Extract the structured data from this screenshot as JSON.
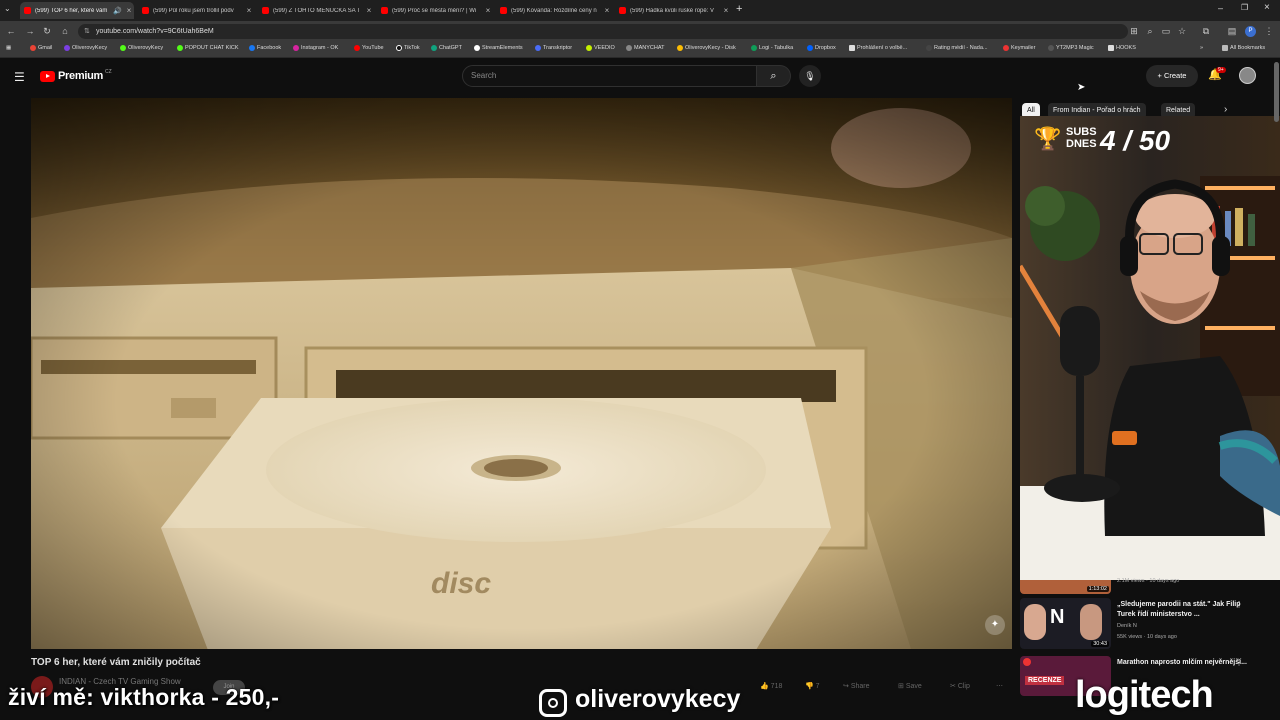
{
  "browser": {
    "tabs": [
      {
        "title": "(599) TOP 6 her, které vám",
        "active": true
      },
      {
        "title": "(599) Půl roku jsem trollil podv",
        "active": false
      },
      {
        "title": "(599) Z TOHTO MENUČKA SA T",
        "active": false
      },
      {
        "title": "(599) Proč se města mění? | Wi",
        "active": false
      },
      {
        "title": "(599) Kovanda: Rozdílné ceny n",
        "active": false
      },
      {
        "title": "(599) Hádka kvůli ruské ropě: V",
        "active": false
      }
    ],
    "url": "youtube.com/watch?v=9C6tUah6BeM",
    "bookmarks": [
      "Gmail",
      "OliverovyKecy",
      "OliverovyKecy",
      "POPOUT CHAT KICK",
      "Facebook",
      "Instagram - OK",
      "YouTube",
      "TikTok",
      "ChatGPT",
      "StreamElements",
      "Transkriptor",
      "VEEDIO",
      "MANYCHAT",
      "OliverovyKecy - Disk",
      "Logi - Tabulka",
      "Dropbox",
      "Prohlášení o volbě...",
      "Rating médií - Nada...",
      "Keymailer",
      "YT2MP3 Magic",
      "HOOKS"
    ],
    "all_bookmarks": "All Bookmarks"
  },
  "youtube": {
    "logo_text": "Premium",
    "country": "CZ",
    "search_placeholder": "Search",
    "create_label": "Create",
    "notif_count": "9+",
    "chips": [
      "All",
      "From Indian - Pořad o hrách",
      "Related"
    ],
    "video_title": "TOP 6 her, které vám zničily počítač",
    "channel": "INDIAN - Czech TV Gaming Show",
    "join_label": "Join",
    "actions": {
      "likes": "718",
      "dislikes": "7",
      "share": "Share",
      "save": "Save",
      "clip": "Clip"
    },
    "video_disc_text": "disc",
    "related": [
      {
        "title": "",
        "meta": "2.1M views · 10 days ago",
        "duration": "1:13:02"
      },
      {
        "title": "„Sledujeme parodii na stát.\" Jak Filip Turek řídí ministerstvo ...",
        "channel": "Deník N",
        "meta": "55K views · 10 days ago",
        "duration": "30:43",
        "thumb_badge": "N"
      },
      {
        "title": "Marathon naprosto mlčím nejvěrnější...",
        "meta": "",
        "duration": "",
        "thumb_badge": "RECENZE"
      }
    ]
  },
  "overlay": {
    "subs_label": "SUBS DNES",
    "subs_count": "4 / 50",
    "bottom_left": "živí mě: vikthorka - 250,-",
    "instagram": "oliverovykecy",
    "sponsor": "logitech"
  },
  "colors": {
    "yt_red": "#ff0000",
    "bg": "#0f0f0f"
  }
}
